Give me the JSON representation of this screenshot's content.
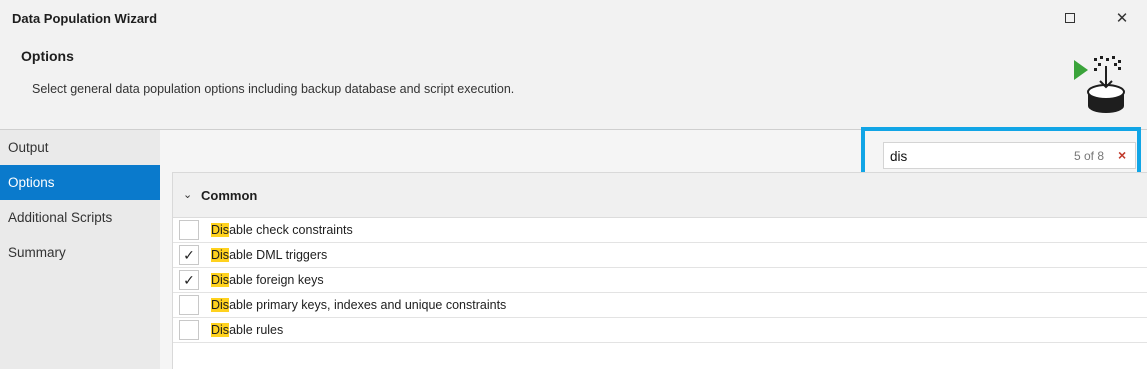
{
  "window": {
    "title": "Data Population Wizard",
    "maximize_icon": "maximize-icon",
    "close_glyph": "✕"
  },
  "header": {
    "title": "Options",
    "description": "Select general data population options including backup database and script execution.",
    "icon": "data-population-icon",
    "colors": {
      "play": "#3aa33a",
      "database": "#1e1e1e"
    }
  },
  "sidebar": {
    "items": [
      {
        "label": "Output",
        "active": false
      },
      {
        "label": "Options",
        "active": true
      },
      {
        "label": "Additional Scripts",
        "active": false
      },
      {
        "label": "Summary",
        "active": false
      }
    ],
    "active_color": "#0a7acc"
  },
  "search": {
    "value": "dis",
    "match_count": "5 of 8",
    "clear_glyph": "×",
    "highlight_color": "#11a5e6"
  },
  "group": {
    "chevron": "⌄",
    "title": "Common",
    "options": [
      {
        "match": "Dis",
        "rest": "able check constraints",
        "checked": false
      },
      {
        "match": "Dis",
        "rest": "able DML triggers",
        "checked": true
      },
      {
        "match": "Dis",
        "rest": "able foreign keys",
        "checked": true
      },
      {
        "match": "Dis",
        "rest": "able primary keys, indexes and unique constraints",
        "checked": false
      },
      {
        "match": "Dis",
        "rest": "able rules",
        "checked": false
      }
    ],
    "match_highlight_color": "#ffd21f"
  }
}
